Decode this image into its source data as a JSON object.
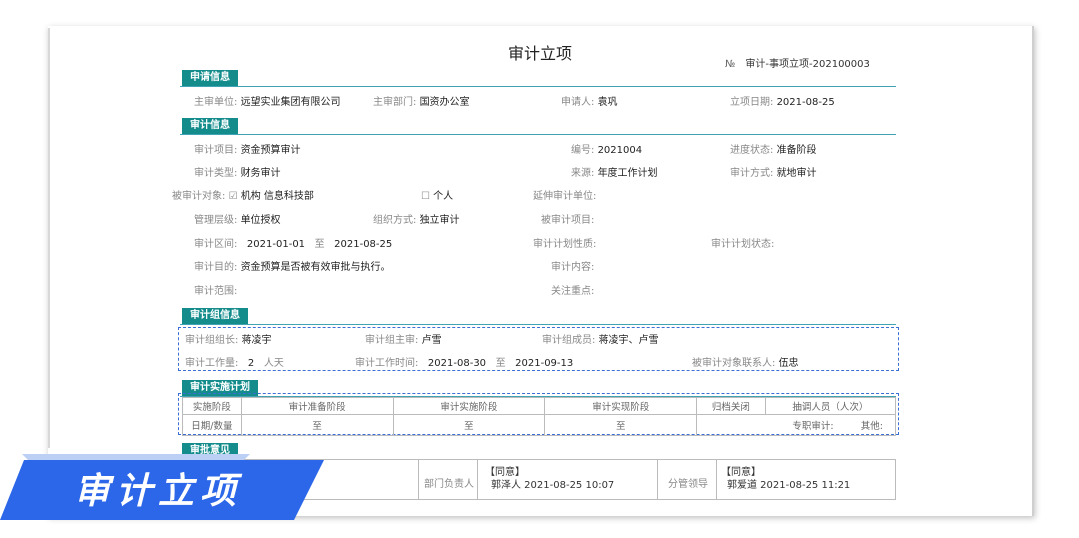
{
  "doc": {
    "title": "审计立项",
    "no_label": "№",
    "no_value": "审计-事项立项-202100003"
  },
  "sections": {
    "apply": "申请信息",
    "audit": "审计信息",
    "team": "审计组信息",
    "plan": "审计实施计划",
    "opinion": "审批意见"
  },
  "apply": {
    "unit_k": "主审单位:",
    "unit_v": "远望实业集团有限公司",
    "dept_k": "主审部门:",
    "dept_v": "国资办公室",
    "applicant_k": "申请人:",
    "applicant_v": "袁巩",
    "date_k": "立项日期:",
    "date_v": "2021-08-25"
  },
  "audit": {
    "item_k": "审计项目:",
    "item_v": "资金预算审计",
    "code_k": "编号:",
    "code_v": "2021004",
    "status_k": "进度状态:",
    "status_v": "准备阶段",
    "type_k": "审计类型:",
    "type_v": "财务审计",
    "source_k": "来源:",
    "source_v": "年度工作计划",
    "mode_k": "审计方式:",
    "mode_v": "就地审计",
    "target_k": "被审计对象:",
    "target_check1": "☑",
    "target_v1": "机构",
    "target_v2": "信息科技部",
    "target_check2": "☐",
    "target_v3": "个人",
    "extend_k": "延伸审计单位:",
    "level_k": "管理层级:",
    "level_v": "单位授权",
    "org_k": "组织方式:",
    "org_v": "独立审计",
    "audited_item_k": "被审计项目:",
    "range_k": "审计区间:",
    "range_from": "2021-01-01",
    "range_to_word": "至",
    "range_to": "2021-08-25",
    "nature_k": "审计计划性质:",
    "plan_status_k": "审计计划状态:",
    "purpose_k": "审计目的:",
    "purpose_v": "资金预算是否被有效审批与执行。",
    "content_k": "审计内容:",
    "scope_k": "审计范围:",
    "focus_k": "关注重点:"
  },
  "team": {
    "leader_k": "审计组组长:",
    "leader_v": "蒋凌宇",
    "chief_k": "审计组主审:",
    "chief_v": "卢雪",
    "members_k": "审计组成员:",
    "members_v": "蒋凌宇、卢雪",
    "workload_k": "审计工作量:",
    "workload_v": "2",
    "workload_unit": "人天",
    "time_k": "审计工作时间:",
    "time_from": "2021-08-30",
    "time_to_word": "至",
    "time_to": "2021-09-13",
    "contact_k": "被审计对象联系人:",
    "contact_v": "伍忠"
  },
  "plan": {
    "headers": [
      "实施阶段",
      "审计准备阶段",
      "审计实施阶段",
      "审计实现阶段",
      "归档关闭",
      "抽调人员（人次）"
    ],
    "row_label": "日期/数量",
    "cells": [
      "至",
      "至",
      "至"
    ],
    "dedicated_k": "专职审计:",
    "other_k": "其他:"
  },
  "opinion": {
    "dept_head_k": "部门负责人",
    "dept_head_result": "【同意】",
    "dept_head_sign": "郭泽人 2021-08-25 10:07",
    "leader_k": "分管领导",
    "leader_result": "【同意】",
    "leader_sign": "郭爱道 2021-08-25 11:21"
  },
  "banner": {
    "text": "审计立项"
  },
  "colors": {
    "section": "#148c8c",
    "dash": "#3b6fd6",
    "banner": "#2b67e8"
  }
}
